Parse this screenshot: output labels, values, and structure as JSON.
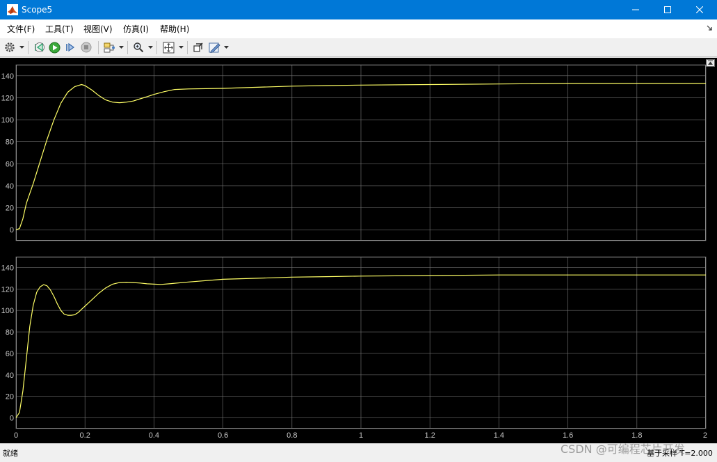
{
  "window": {
    "title": "Scope5"
  },
  "menu": {
    "items": [
      {
        "label": "文件(F)"
      },
      {
        "label": "工具(T)"
      },
      {
        "label": "视图(V)"
      },
      {
        "label": "仿真(I)"
      },
      {
        "label": "帮助(H)"
      }
    ]
  },
  "toolbar": {
    "buttons": [
      "gear-icon",
      "step-back-icon",
      "run-icon",
      "step-forward-icon",
      "stop-icon",
      "signal-select-icon",
      "zoom-icon",
      "autoscale-icon",
      "highlight-block-icon",
      "style-icon"
    ]
  },
  "colors": {
    "titlebar": "#0078d7",
    "trace": "#ffff66",
    "axes": "#000000",
    "grid": "#6e6e6e",
    "ticks": "#c8c8c8",
    "frame": "#2a2a2a"
  },
  "chart_data": [
    {
      "type": "line",
      "title": "",
      "xlabel": "",
      "ylabel": "",
      "xlim": [
        0,
        2
      ],
      "ylim": [
        -10,
        150
      ],
      "x_ticks": [
        0,
        0.2,
        0.4,
        0.6,
        0.8,
        1,
        1.2,
        1.4,
        1.6,
        1.8,
        2
      ],
      "y_ticks": [
        0,
        20,
        40,
        60,
        80,
        100,
        120,
        140
      ],
      "grid": true,
      "series": [
        {
          "x": [
            0,
            0.01,
            0.02,
            0.03,
            0.05,
            0.07,
            0.09,
            0.11,
            0.13,
            0.15,
            0.17,
            0.19,
            0.2,
            0.22,
            0.24,
            0.26,
            0.28,
            0.3,
            0.32,
            0.34,
            0.36,
            0.38,
            0.4,
            0.43,
            0.46,
            0.5,
            0.6,
            0.7,
            0.8,
            0.9,
            1.0,
            1.2,
            1.4,
            1.6,
            1.8,
            2.0
          ],
          "y": [
            0,
            1,
            10,
            24,
            42,
            62,
            82,
            100,
            115,
            125,
            130,
            132,
            131,
            127,
            122,
            118,
            116,
            115.5,
            116,
            117,
            119,
            121,
            123,
            125.5,
            127.5,
            128,
            128.5,
            129.5,
            130.5,
            131,
            131.5,
            132,
            132.5,
            133,
            133,
            133
          ]
        }
      ]
    },
    {
      "type": "line",
      "title": "",
      "xlabel": "",
      "ylabel": "",
      "xlim": [
        0,
        2
      ],
      "ylim": [
        -10,
        150
      ],
      "x_ticks": [
        0,
        0.2,
        0.4,
        0.6,
        0.8,
        1,
        1.2,
        1.4,
        1.6,
        1.8,
        2
      ],
      "x_tick_labels": [
        "0",
        "0.2",
        "0.4",
        "0.6",
        "0.8",
        "1",
        "1.2",
        "1.4",
        "1.6",
        "1.8",
        "2"
      ],
      "y_ticks": [
        0,
        20,
        40,
        60,
        80,
        100,
        120,
        140
      ],
      "grid": true,
      "series": [
        {
          "x": [
            0,
            0.01,
            0.02,
            0.03,
            0.04,
            0.05,
            0.06,
            0.07,
            0.08,
            0.09,
            0.1,
            0.11,
            0.12,
            0.13,
            0.14,
            0.15,
            0.16,
            0.17,
            0.18,
            0.19,
            0.2,
            0.22,
            0.24,
            0.26,
            0.28,
            0.3,
            0.32,
            0.34,
            0.36,
            0.38,
            0.4,
            0.42,
            0.45,
            0.5,
            0.6,
            0.7,
            0.8,
            0.9,
            1.0,
            1.2,
            1.4,
            1.6,
            1.8,
            2.0
          ],
          "y": [
            0,
            5,
            25,
            55,
            85,
            105,
            117,
            122,
            124,
            123,
            119,
            113,
            106,
            100,
            96.5,
            95.5,
            95.5,
            96,
            98,
            101,
            104,
            110,
            116,
            121,
            124.5,
            126,
            126.3,
            126,
            125.5,
            124.8,
            124.5,
            124.2,
            125,
            126.5,
            129,
            130,
            131,
            131.5,
            132,
            132.5,
            133,
            133,
            133,
            133
          ]
        }
      ]
    }
  ],
  "status": {
    "left": "就绪",
    "right": "基于采样 T=2.000"
  },
  "watermark": "CSDN @可编程芯片开发"
}
